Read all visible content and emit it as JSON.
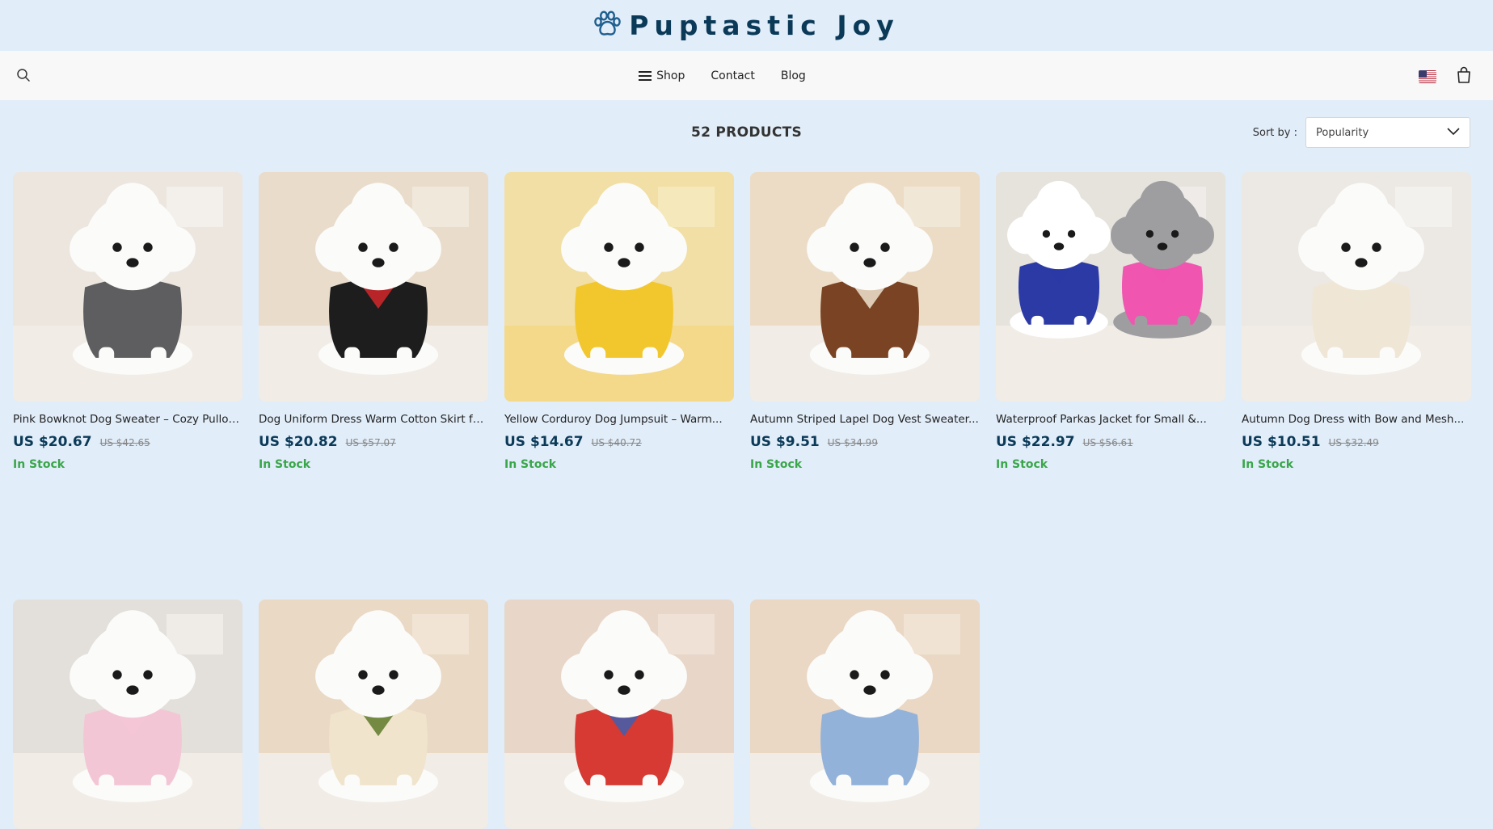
{
  "brand": {
    "name": "Puptastic Joy",
    "icon": "paw-icon",
    "color": "#0b3a58"
  },
  "nav": {
    "links": [
      {
        "label": "Shop",
        "icon": "menu-icon"
      },
      {
        "label": "Contact"
      },
      {
        "label": "Blog"
      }
    ],
    "search_icon": "search-icon",
    "flag_icon": "us-flag-icon",
    "cart_icon": "shopping-bag-icon"
  },
  "listing": {
    "count": "52 PRODUCTS",
    "sort_label": "Sort by :",
    "sort_value": "Popularity"
  },
  "products": [
    {
      "title": "Pink Bowknot Dog Sweater – Cozy Pullov...",
      "price": "US $20.67",
      "old_price": "US $42.65",
      "stock": "In Stock",
      "bg": [
        "#ece6df",
        "#f6f3ef"
      ],
      "garment": "#5e5e60",
      "scene": "room"
    },
    {
      "title": "Dog Uniform Dress Warm Cotton Skirt for...",
      "price": "US $20.82",
      "old_price": "US $57.07",
      "stock": "In Stock",
      "bg": [
        "#e9dccb",
        "#f4ede3"
      ],
      "garment": "#1d1d1d",
      "accent": "#d3272a",
      "scene": "room"
    },
    {
      "title": "Yellow Corduroy Dog Jumpsuit – Warm...",
      "price": "US $14.67",
      "old_price": "US $40.72",
      "stock": "In Stock",
      "bg": [
        "#f2dfa5",
        "#f7ecc5"
      ],
      "garment": "#f2c72e",
      "scene": "bed"
    },
    {
      "title": "Autumn Striped Lapel Dog Vest Sweater...",
      "price": "US $9.51",
      "old_price": "US $34.99",
      "stock": "In Stock",
      "bg": [
        "#ecdcc6",
        "#f4ebde"
      ],
      "garment": "#7a4324",
      "accent": "#efe3cf",
      "scene": "room"
    },
    {
      "title": "Waterproof Parkas Jacket for Small &...",
      "price": "US $22.97",
      "old_price": "US $56.61",
      "stock": "In Stock",
      "bg": [
        "#e6e2dc",
        "#f1efec"
      ],
      "garment": "#2c3aa6",
      "accent": "#f055b0",
      "scene": "pair"
    },
    {
      "title": "Autumn Dog Dress with Bow and Mesh...",
      "price": "US $10.51",
      "old_price": "US $32.49",
      "stock": "In Stock",
      "bg": [
        "#ece8e3",
        "#f7f5f2"
      ],
      "garment": "#efe6d6",
      "scene": "room"
    },
    {
      "title": "",
      "price": "",
      "old_price": "",
      "stock": "",
      "bg": [
        "#e3e0db",
        "#f3f1ee"
      ],
      "garment": "#f3c6d6",
      "scene": "room"
    },
    {
      "title": "",
      "price": "",
      "old_price": "",
      "stock": "",
      "bg": [
        "#ead9c5",
        "#f3e8da"
      ],
      "garment": "#f0e4cc",
      "accent": "#5e7a2a",
      "scene": "room"
    },
    {
      "title": "",
      "price": "",
      "old_price": "",
      "stock": "",
      "bg": [
        "#e8d6c8",
        "#f2e6dc"
      ],
      "garment": "#d63a33",
      "accent": "#3f5fae",
      "scene": "room"
    },
    {
      "title": "",
      "price": "",
      "old_price": "",
      "stock": "",
      "bg": [
        "#ead7c4",
        "#f4e8dc"
      ],
      "garment": "#93b2d9",
      "scene": "room"
    }
  ]
}
